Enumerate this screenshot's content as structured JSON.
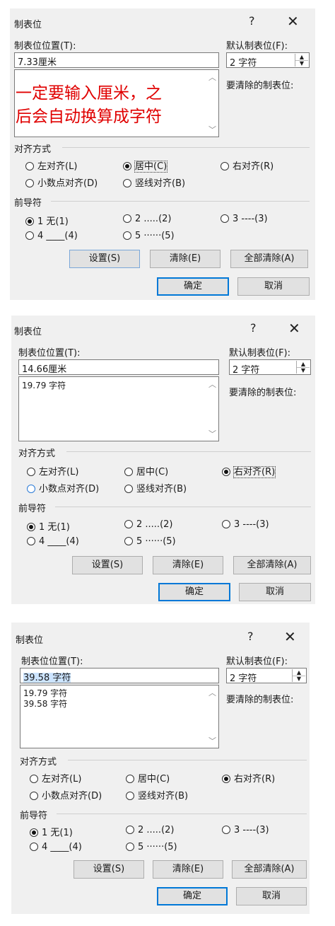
{
  "dialog1": {
    "title": "制表位",
    "help": "?",
    "close": "✕",
    "position_label": "制表位位置(T):",
    "position_value": "7.33厘米",
    "default_label": "默认制表位(F):",
    "default_value": "2 字符",
    "clear_label": "要清除的制表位:",
    "list": [],
    "align_label": "对齐方式",
    "align": [
      "左对齐(L)",
      "居中(C)",
      "右对齐(R)",
      "小数点对齐(D)",
      "竖线对齐(B)"
    ],
    "leader_label": "前导符",
    "leader": [
      "1 无(1)",
      "2 .....(2)",
      "3 ----(3)",
      "4 ____(4)",
      "5 ······(5)"
    ],
    "buttons": {
      "set": "设置(S)",
      "clear": "清除(E)",
      "clear_all": "全部清除(A)",
      "ok": "确定",
      "cancel": "取消"
    },
    "annotation": [
      "一定要输入厘米，之",
      "后会自动换算成字符"
    ]
  },
  "dialog2": {
    "title": "制表位",
    "help": "?",
    "close": "✕",
    "position_label": "制表位位置(T):",
    "position_value": "14.66厘米",
    "default_label": "默认制表位(F):",
    "default_value": "2 字符",
    "clear_label": "要清除的制表位:",
    "list": [
      "19.79 字符"
    ],
    "align_label": "对齐方式",
    "align": [
      "左对齐(L)",
      "居中(C)",
      "右对齐(R)",
      "小数点对齐(D)",
      "竖线对齐(B)"
    ],
    "leader_label": "前导符",
    "leader": [
      "1 无(1)",
      "2 .....(2)",
      "3 ----(3)",
      "4 ____(4)",
      "5 ······(5)"
    ],
    "buttons": {
      "set": "设置(S)",
      "clear": "清除(E)",
      "clear_all": "全部清除(A)",
      "ok": "确定",
      "cancel": "取消"
    }
  },
  "dialog3": {
    "title": "制表位",
    "help": "?",
    "close": "✕",
    "position_label": "制表位位置(T):",
    "position_value": "39.58 字符",
    "default_label": "默认制表位(F):",
    "default_value": "2 字符",
    "clear_label": "要清除的制表位:",
    "list": [
      "19.79 字符",
      "39.58 字符"
    ],
    "align_label": "对齐方式",
    "align": [
      "左对齐(L)",
      "居中(C)",
      "右对齐(R)",
      "小数点对齐(D)",
      "竖线对齐(B)"
    ],
    "leader_label": "前导符",
    "leader": [
      "1 无(1)",
      "2 .....(2)",
      "3 ----(3)",
      "4 ____(4)",
      "5 ······(5)"
    ],
    "buttons": {
      "set": "设置(S)",
      "clear": "清除(E)",
      "clear_all": "全部清除(A)",
      "ok": "确定",
      "cancel": "取消"
    }
  },
  "spinner": {
    "up": "▲",
    "down": "▼"
  },
  "scroll": {
    "up": "︿",
    "down": "﹀"
  }
}
